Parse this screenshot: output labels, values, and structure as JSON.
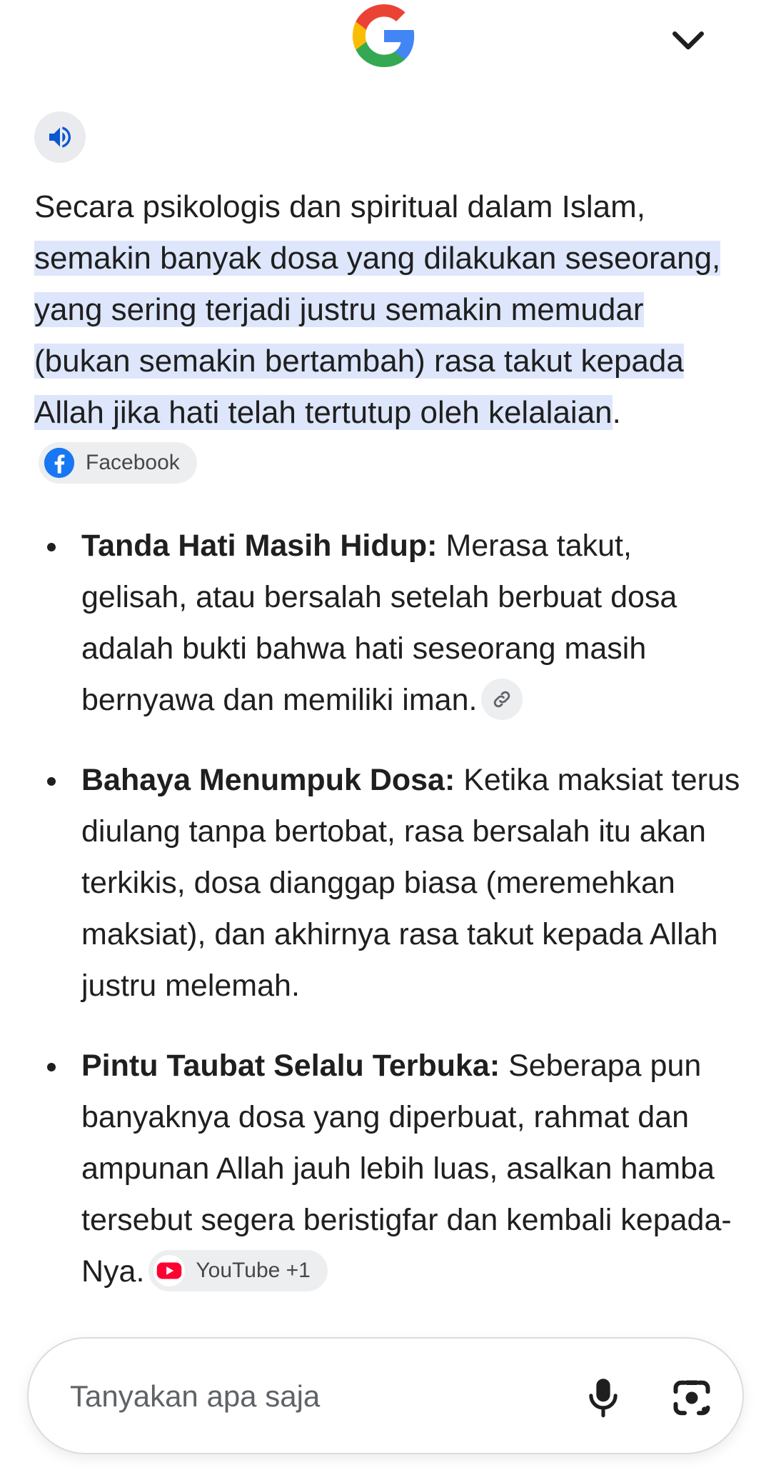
{
  "header": {
    "logo_icon": "google-g-icon",
    "menu_icon": "chevron-down-icon"
  },
  "speaker": {
    "icon": "speaker-volume-icon"
  },
  "answer": {
    "intro_plain": "Secara psikologis dan spiritual dalam Islam,",
    "intro_highlight": " semakin banyak dosa yang dilakukan seseorang, yang sering terjadi justru semakin memudar (bukan semakin bertambah) rasa takut kepada Allah jika hati telah tertutup oleh kelalaian",
    "intro_end": ".",
    "intro_source": "Facebook",
    "bullets": [
      {
        "title": "Tanda Hati Masih Hidup:",
        "text": " Merasa takut, gelisah, atau bersalah setelah berbuat dosa adalah bukti bahwa hati seseorang masih bernyawa dan memiliki iman."
      },
      {
        "title": "Bahaya Menumpuk Dosa:",
        "text": " Ketika maksiat terus diulang tanpa bertobat, rasa bersalah itu akan terkikis, dosa dianggap biasa (meremehkan maksiat), dan akhirnya rasa takut kepada Allah justru melemah."
      },
      {
        "title": "Pintu Taubat Selalu Terbuka:",
        "text": " Seberapa pun banyaknya dosa yang diperbuat, rahmat dan ampunan Allah jauh lebih luas, asalkan hamba tersebut segera beristigfar dan kembali kepada-Nya.",
        "source": "YouTube +1"
      }
    ]
  },
  "ask_bar": {
    "placeholder": "Tanyakan apa saja",
    "value": ""
  },
  "colors": {
    "highlight": "#dde6fb",
    "chip_bg": "#eceef0",
    "facebook_blue": "#1877f2",
    "youtube_red": "#ff0033",
    "speaker_blue": "#0b57d0"
  }
}
